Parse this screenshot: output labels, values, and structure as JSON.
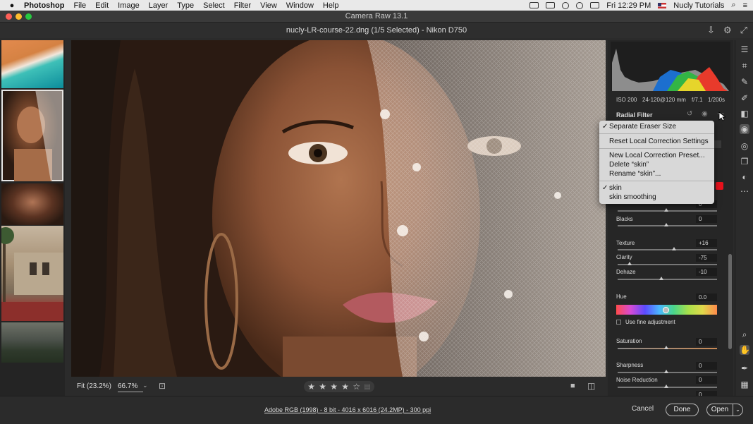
{
  "menubar": {
    "app_name": "Photoshop",
    "items": [
      "File",
      "Edit",
      "Image",
      "Layer",
      "Type",
      "Select",
      "Filter",
      "View",
      "Window",
      "Help"
    ],
    "clock": "Fri 12:29 PM",
    "user": "Nucly Tutorials"
  },
  "window": {
    "title": "Camera Raw 13.1"
  },
  "file_header": {
    "file_info": "nucly-LR-course-22.dng (1/5 Selected)  -  Nikon D750"
  },
  "panel": {
    "exif": {
      "iso": "ISO 200",
      "lens": "24-120@120 mm",
      "aperture": "f/7.1",
      "shutter": "1/200s"
    },
    "section_title": "Radial Filter",
    "whites_value": "0",
    "blacks_label": "Blacks",
    "blacks_value": "0",
    "texture_label": "Texture",
    "texture_value": "+16",
    "clarity_label": "Clarity",
    "clarity_value": "-75",
    "dehaze_label": "Dehaze",
    "dehaze_value": "-10",
    "hue_label": "Hue",
    "hue_value": "0.0",
    "fine_adjust_label": "Use fine adjustment",
    "saturation_label": "Saturation",
    "saturation_value": "0",
    "sharpness_label": "Sharpness",
    "sharpness_value": "0",
    "noise_label": "Noise Reduction",
    "noise_value": "0",
    "moire_value": "0",
    "slider_positions": {
      "whites": 0.5,
      "blacks": 0.5,
      "texture": 0.58,
      "clarity": 0.125,
      "dehaze": 0.45,
      "hue": 0.5,
      "saturation": 0.5,
      "sharpness": 0.5,
      "noise": 0.5
    },
    "accent_red": "#e8121c"
  },
  "menu": {
    "items": {
      "separate_eraser": "Separate Eraser Size",
      "reset_local": "Reset Local Correction Settings",
      "new_preset": "New Local Correction Preset...",
      "delete_skin": "Delete “skin”",
      "rename_skin": "Rename “skin”...",
      "skin": "skin",
      "skin_smoothing": "skin smoothing"
    },
    "checked": [
      "separate_eraser",
      "skin"
    ]
  },
  "viewer": {
    "fit_label": "Fit (23.2%)",
    "zoom_value": "66.7%",
    "rating": 4,
    "rating_max": 5
  },
  "footer": {
    "image_info": "Adobe RGB (1998) - 8 bit - 4016 x 6016 (24.2MP) - 300 ppi",
    "cancel": "Cancel",
    "done": "Done",
    "open": "Open"
  },
  "icons": {
    "toolstrip": [
      "sliders-icon",
      "crop-icon",
      "healing-icon",
      "brush-icon",
      "gradient-icon",
      "radial-filter-icon",
      "redeye-icon",
      "snapshots-icon",
      "presets-icon",
      "more-icon",
      "zoom-icon",
      "hand-icon",
      "color-sampler-icon",
      "grid-icon"
    ]
  }
}
